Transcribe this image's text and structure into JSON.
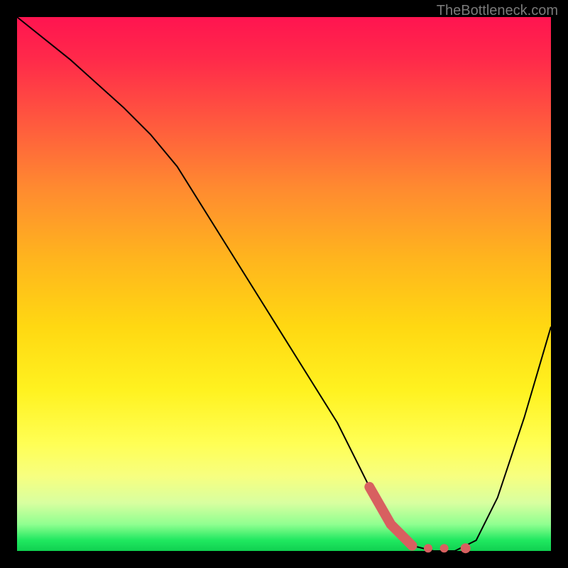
{
  "watermark": "TheBottleneck.com",
  "chart_data": {
    "type": "line",
    "title": "",
    "xlabel": "",
    "ylabel": "",
    "xlim": [
      0,
      100
    ],
    "ylim": [
      0,
      100
    ],
    "series": [
      {
        "name": "bottleneck-curve",
        "x": [
          0,
          10,
          20,
          25,
          30,
          40,
          50,
          60,
          66,
          70,
          74,
          78,
          82,
          86,
          90,
          95,
          100
        ],
        "y": [
          100,
          92,
          83,
          78,
          72,
          56,
          40,
          24,
          12,
          5,
          1,
          0,
          0,
          2,
          10,
          25,
          42
        ]
      }
    ],
    "highlight_segment": {
      "x": [
        66,
        70,
        74
      ],
      "y": [
        12,
        5,
        1
      ]
    },
    "dots": [
      {
        "x": 77,
        "y": 0.5
      },
      {
        "x": 80,
        "y": 0.5
      },
      {
        "x": 84,
        "y": 0.5
      }
    ],
    "gradient_stops": [
      {
        "pos": 0,
        "color": "#ff1450"
      },
      {
        "pos": 100,
        "color": "#10d050"
      }
    ]
  }
}
